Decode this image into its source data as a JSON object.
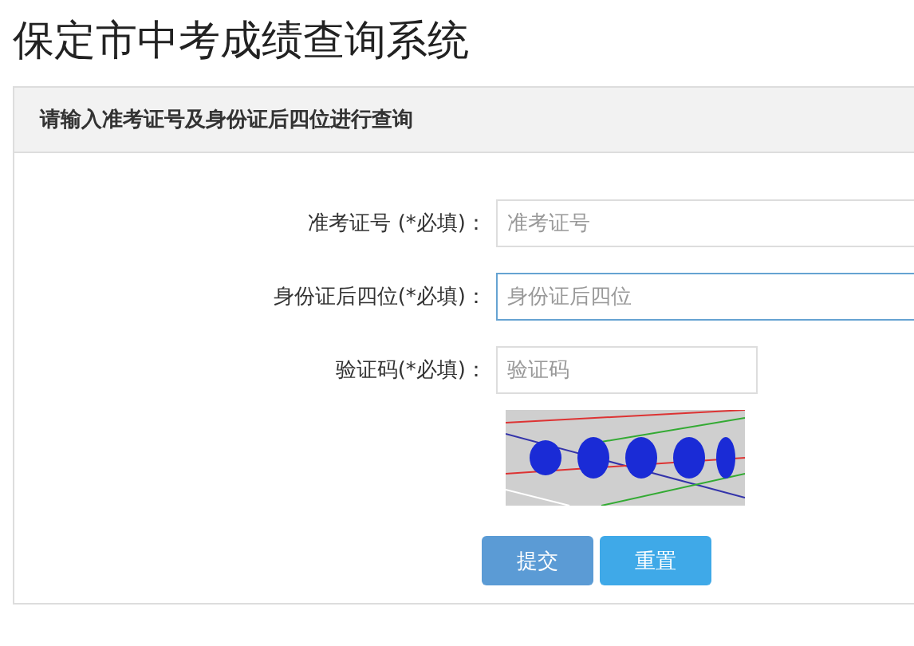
{
  "page_title": "保定市中考成绩查询系统",
  "panel": {
    "heading": "请输入准考证号及身份证后四位进行查询",
    "fields": [
      {
        "label": "准考证号 (*必填)：",
        "placeholder": "准考证号",
        "focused": false,
        "kind": "wide"
      },
      {
        "label": "身份证后四位(*必填)：",
        "placeholder": "身份证后四位",
        "focused": true,
        "kind": "wide"
      },
      {
        "label": "验证码(*必填)：",
        "placeholder": "验证码",
        "focused": false,
        "kind": "short"
      }
    ],
    "buttons": [
      {
        "label": "提交",
        "kind": "submit"
      },
      {
        "label": "重置",
        "kind": "reset"
      }
    ]
  }
}
